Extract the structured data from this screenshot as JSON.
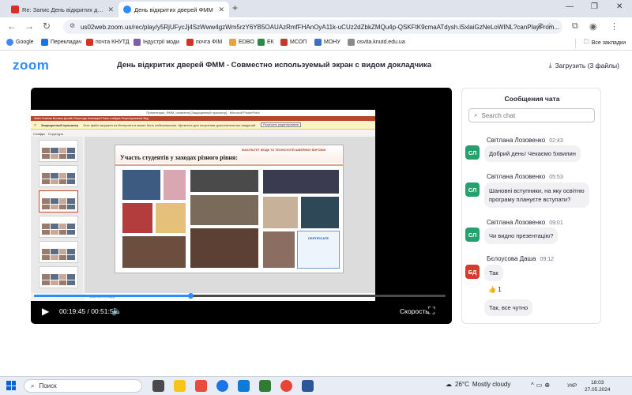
{
  "browser": {
    "tabs": [
      {
        "title": "Re: Запис День відкритих двер",
        "favicon": "mail-icon"
      },
      {
        "title": "День відкритих дверей ФММ",
        "favicon": "zoom-icon"
      }
    ],
    "url": "us02web.zoom.us/rec/play/y5RjUFycJj4SzWww4gzWm5rzY6YB5OAUAzRmfFHAnOyA11k-uCUz2dZbkZMQu4p-QSKFtK9cmaATdysh.iSxlaiGzNeLoWINL?canPlayFrom...",
    "bookmarks": [
      "Google",
      "Перекладач",
      "почта КНУТД",
      "Індустрії моди",
      "почта ФІМ",
      "EDBO",
      "ЕК",
      "МСОП",
      "МОНУ",
      "osvita.knutd.edu.ua"
    ],
    "all_bookmarks": "Все закладки"
  },
  "zoom": {
    "logo": "zoom",
    "recording_title": "День відкритих дверей ФММ - Совместно используемый экран с видом докладчика",
    "download_label": "Загрузить (3 файлы)"
  },
  "slide": {
    "ppt_window_title": "Презентація_ФММ_оновлена [Защищенный просмотр] - Microsoft PowerPoint",
    "ribbon": "Файл   Главная   Вставка   Дизайн   Переходы   Анимация   Показ слайдов   Рецензирование   Вид",
    "protected_label": "Защищенный просмотр",
    "protected_text": "Этот файл загружен из Интернета и может быть небезопасным. Щелкните для получения дополнительных сведений.",
    "protected_button": "Разрешить редактирование",
    "panel_tabs": [
      "Слайды",
      "Структура"
    ],
    "faculty_header": "ФАКУЛЬТЕТ МОДИ ТА ТЕХНОЛОГІЙ ШВЕЙНИХ ВИРОБІВ",
    "title": "Участь студентів у заходах різного рівня:",
    "certificate": "CERTIFICATE",
    "notes_placeholder": "Заметки к слайду"
  },
  "player": {
    "current_time": "00:19:45",
    "total_time": "00:51:54",
    "progress": 0.38,
    "speed_label": "Скорость"
  },
  "chat": {
    "title": "Сообщения чата",
    "search_placeholder": "Search chat",
    "messages": [
      {
        "author": "Світлана Лозовенко",
        "time": "02:43",
        "initials": "СЛ",
        "text": "Добрий день! Чекаємо 5хвилин"
      },
      {
        "author": "Світлана Лозовенко",
        "time": "05:53",
        "initials": "СЛ",
        "text_line1": "Шановні вступники, на яку освітню",
        "text_line2": "програму плануєте вступати?"
      },
      {
        "author": "Світлана Лозовенко",
        "time": "09:01",
        "initials": "СЛ",
        "text": "Чи видно презентацію?"
      },
      {
        "author": "Бєлоусова Даша",
        "time": "09:12",
        "initials": "БД",
        "text": "Так",
        "reaction_count": "1",
        "followup": "Так, все чутно"
      }
    ]
  },
  "taskbar": {
    "search_label": "Поиск",
    "weather_temp": "26°C",
    "weather_text": "Mostly cloudy",
    "language": "УКР",
    "time": "18:03",
    "date": "27.05.2024"
  },
  "colors": {
    "zoom_blue": "#2d8cff",
    "avatar_green": "#23a26d",
    "avatar_red": "#d63a2f"
  }
}
